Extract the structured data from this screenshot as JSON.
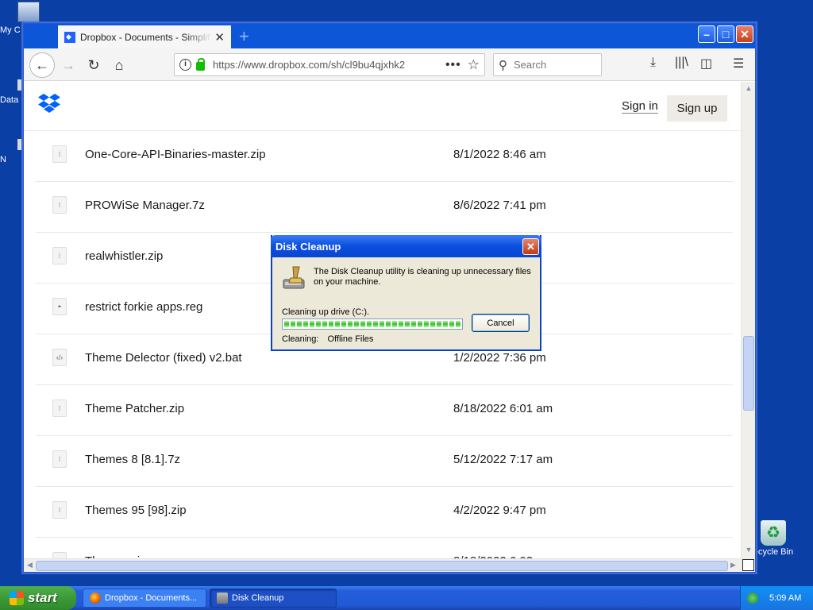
{
  "desktop": {
    "icons": [
      {
        "label": "My C"
      },
      {
        "label": "Data"
      },
      {
        "label": "N"
      },
      {
        "label": "ecycle Bin"
      }
    ]
  },
  "browser": {
    "tab_title": "Dropbox - Documents - Simplify yo",
    "tab_close": "✕",
    "new_tab": "+",
    "url": "https://www.dropbox.com/sh/cl9bu4qjxhk2",
    "page_actions": "•••",
    "search_placeholder": "Search",
    "window_buttons": {
      "minimize": "–",
      "maximize": "□",
      "close": "✕"
    }
  },
  "page": {
    "sign_in": "Sign in",
    "sign_up": "Sign up",
    "files": [
      {
        "name": "One-Core-API-Binaries-master.zip",
        "date": "8/1/2022 8:46 am",
        "icon": "zip-file-icon"
      },
      {
        "name": "PROWiSe Manager.7z",
        "date": "8/6/2022 7:41 pm",
        "icon": "zip-file-icon"
      },
      {
        "name": "realwhistler.zip",
        "date": "am",
        "icon": "zip-file-icon"
      },
      {
        "name": "restrict forkie apps.reg",
        "date": "am",
        "icon": "registry-file-icon"
      },
      {
        "name": "Theme Delector (fixed) v2.bat",
        "date": "1/2/2022 7:36 pm",
        "icon": "code-file-icon"
      },
      {
        "name": "Theme Patcher.zip",
        "date": "8/18/2022 6:01 am",
        "icon": "zip-file-icon"
      },
      {
        "name": "Themes 8 [8.1].7z",
        "date": "5/12/2022 7:17 am",
        "icon": "zip-file-icon"
      },
      {
        "name": "Themes 95 [98].zip",
        "date": "4/2/2022 9:47 pm",
        "icon": "zip-file-icon"
      },
      {
        "name": "Themes.zip",
        "date": "8/18/2022 6:02 am",
        "icon": "zip-file-icon"
      }
    ]
  },
  "dialog": {
    "title": "Disk Cleanup",
    "message": "The Disk Cleanup utility is cleaning up unnecessary files on your machine.",
    "drive_label": "Cleaning up drive  (C:).",
    "progress_fraction": 1.0,
    "cancel": "Cancel",
    "status_label": "Cleaning:",
    "status_value": "Offline Files"
  },
  "taskbar": {
    "start": "start",
    "buttons": [
      {
        "label": "Dropbox - Documents...",
        "active": false
      },
      {
        "label": "Disk Cleanup",
        "active": true
      }
    ],
    "clock": "5:09 AM"
  },
  "colors": {
    "desktop": "#0a3fa6",
    "dropbox_blue": "#0061fe",
    "xp_title": "#0a4fdc",
    "progress_green": "#2fbf28"
  }
}
